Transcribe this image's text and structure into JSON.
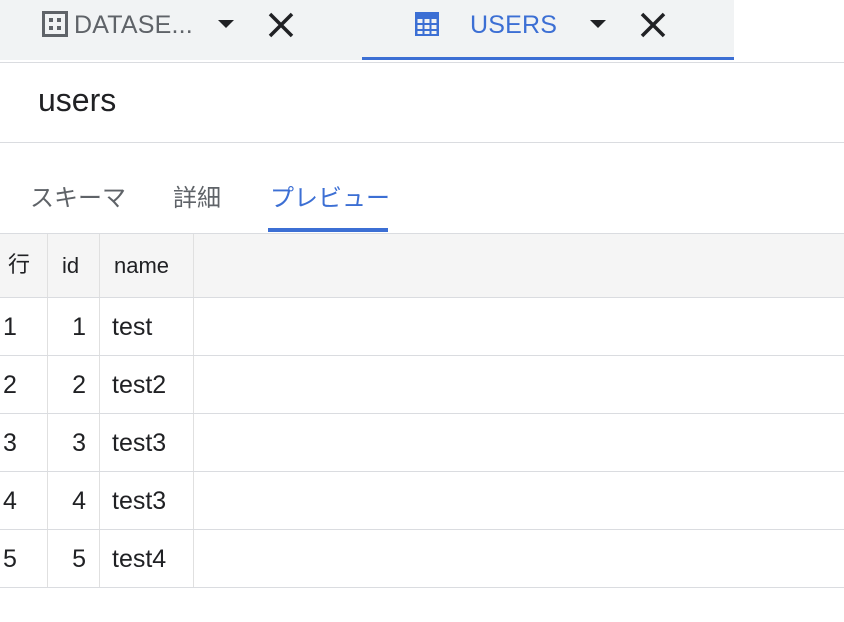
{
  "tabs": [
    {
      "label": "DATASE...",
      "icon": "dataset-icon",
      "active": false
    },
    {
      "label": "USERS",
      "icon": "table-icon",
      "active": true
    }
  ],
  "page": {
    "title": "users"
  },
  "subtabs": [
    {
      "label": "スキーマ"
    },
    {
      "label": "詳細"
    },
    {
      "label": "プレビュー"
    }
  ],
  "table": {
    "headers": {
      "row": "行",
      "id": "id",
      "name": "name"
    },
    "rows": [
      {
        "row": "1",
        "id": "1",
        "name": "test"
      },
      {
        "row": "2",
        "id": "2",
        "name": "test2"
      },
      {
        "row": "3",
        "id": "3",
        "name": "test3"
      },
      {
        "row": "4",
        "id": "4",
        "name": "test3"
      },
      {
        "row": "5",
        "id": "5",
        "name": "test4"
      }
    ]
  },
  "colors": {
    "accent": "#3c6fd4",
    "tab_bg": "#f1f3f4",
    "header_bg": "#f5f5f5",
    "border": "#dadce0",
    "muted_text": "#5f6368"
  }
}
